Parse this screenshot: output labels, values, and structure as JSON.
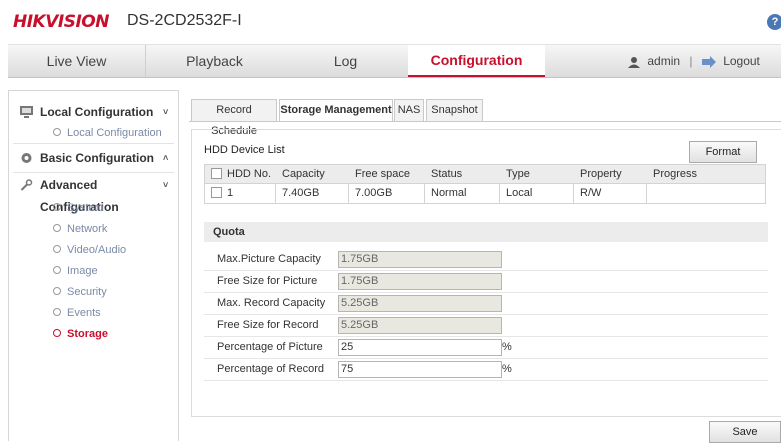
{
  "header": {
    "brand": "HIKVISION",
    "model": "DS-2CD2532F-I",
    "help_icon": "?"
  },
  "topnav": {
    "items": [
      {
        "label": "Live View"
      },
      {
        "label": "Playback"
      },
      {
        "label": "Log"
      },
      {
        "label": "Configuration",
        "active": true
      }
    ],
    "user": "admin",
    "separator": "|",
    "logout": "Logout"
  },
  "sidebar": {
    "local": {
      "title": "Local Configuration",
      "chevron": "˅",
      "items": [
        "Local Configuration"
      ]
    },
    "basic": {
      "title": "Basic Configuration",
      "chevron": "˄"
    },
    "advanced": {
      "title": "Advanced Configuration",
      "chevron": "˅",
      "items": [
        "System",
        "Network",
        "Video/Audio",
        "Image",
        "Security",
        "Events",
        "Storage"
      ],
      "active": "Storage"
    }
  },
  "tabs": [
    "Record Schedule",
    "Storage Management",
    "NAS",
    "Snapshot"
  ],
  "active_tab": "Storage Management",
  "hdd": {
    "title": "HDD Device List",
    "format_button": "Format",
    "columns": [
      "HDD No.",
      "Capacity",
      "Free space",
      "Status",
      "Type",
      "Property",
      "Progress"
    ],
    "rows": [
      {
        "no": "1",
        "capacity": "7.40GB",
        "free": "7.00GB",
        "status": "Normal",
        "type": "Local",
        "property": "R/W",
        "progress": ""
      }
    ]
  },
  "quota": {
    "title": "Quota",
    "fields": [
      {
        "label": "Max.Picture Capacity",
        "value": "1.75GB",
        "readonly": true,
        "unit": ""
      },
      {
        "label": "Free Size for Picture",
        "value": "1.75GB",
        "readonly": true,
        "unit": ""
      },
      {
        "label": "Max. Record Capacity",
        "value": "5.25GB",
        "readonly": true,
        "unit": ""
      },
      {
        "label": "Free Size for Record",
        "value": "5.25GB",
        "readonly": true,
        "unit": ""
      },
      {
        "label": "Percentage of Picture",
        "value": "25",
        "readonly": false,
        "unit": "%"
      },
      {
        "label": "Percentage of Record",
        "value": "75",
        "readonly": false,
        "unit": "%"
      }
    ]
  },
  "save_button": "Save",
  "colors": {
    "brand_red": "#c8102e",
    "link_blue": "#7a8aa6"
  }
}
